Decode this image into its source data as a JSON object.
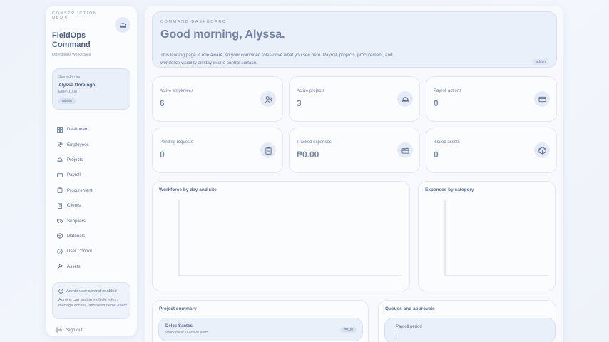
{
  "brand": {
    "superscript": "CONSTRUCTION HRMS",
    "title": "FieldOps Command",
    "subtitle": "Operations workspace"
  },
  "user": {
    "signed_in_label": "Signed in as",
    "name": "Alyssa Doralngo",
    "employee_id": "EMP-1000",
    "role": "admin"
  },
  "nav": {
    "items": [
      {
        "label": "Dashboard",
        "icon": "dashboard-icon"
      },
      {
        "label": "Employees",
        "icon": "users-icon"
      },
      {
        "label": "Projects",
        "icon": "hardhat-icon"
      },
      {
        "label": "Payroll",
        "icon": "card-icon"
      },
      {
        "label": "Procurement",
        "icon": "clipboard-icon"
      },
      {
        "label": "Clients",
        "icon": "building-icon"
      },
      {
        "label": "Suppliers",
        "icon": "truck-icon"
      },
      {
        "label": "Materials",
        "icon": "box-icon"
      },
      {
        "label": "User Control",
        "icon": "user-control-icon"
      },
      {
        "label": "Assets",
        "icon": "wrench-icon"
      }
    ]
  },
  "admin_note": {
    "title": "Admin user control enabled",
    "text": "Admins can assign multiple roles, manage access, and seed demo users."
  },
  "signout_label": "Sign out",
  "hero": {
    "superscript": "COMMAND DASHBOARD",
    "title": "Good morning, Alyssa.",
    "text": "This landing page is role aware, so your combined roles drive what you see here. Payroll, projects, procurement, and workforce visibility all stay in one control surface.",
    "role": "admin"
  },
  "stats": [
    {
      "label": "Active employees",
      "value": "6",
      "icon": "users-icon"
    },
    {
      "label": "Active projects",
      "value": "3",
      "icon": "hardhat-icon"
    },
    {
      "label": "Payroll actions",
      "value": "0",
      "icon": "card-icon"
    },
    {
      "label": "Pending requests",
      "value": "0",
      "icon": "clipboard-icon"
    },
    {
      "label": "Tracked expenses",
      "value": "₱0.00",
      "icon": "wallet-icon"
    },
    {
      "label": "Issued assets",
      "value": "0",
      "icon": "box-icon"
    }
  ],
  "panels": {
    "workforce_title": "Workforce by day and site",
    "expenses_title": "Expenses by category",
    "project_summary_title": "Project summary",
    "queues_title": "Queues and approvals"
  },
  "project_summary": {
    "rows": [
      {
        "name": "Delos Santos",
        "sub": "Workforce: 0 active staff",
        "amount": "₱0.00"
      }
    ]
  },
  "queues": {
    "rows": [
      {
        "name": "Payroll period"
      }
    ]
  },
  "chart_data": [
    {
      "type": "bar",
      "title": "Workforce by day and site",
      "categories": [],
      "series": []
    },
    {
      "type": "pie",
      "title": "Expenses by category",
      "categories": [],
      "values": []
    }
  ]
}
